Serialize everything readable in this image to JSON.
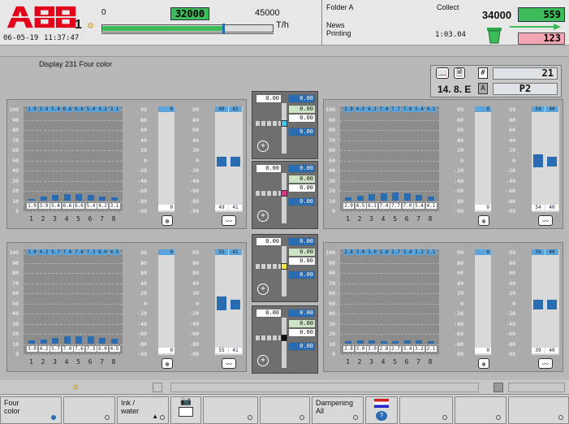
{
  "header": {
    "unit_number": "1",
    "date": "06-05-19",
    "time": "11:37:47",
    "scale_min": "0",
    "speed_current": "32000",
    "scale_max": "45000",
    "speed_unit": "T/h",
    "folder": "Folder A",
    "mode": "Collect",
    "news_line1": "News",
    "news_line2": "Printing",
    "elapsed": "1:03.04",
    "counter_total": "34000",
    "counter_good": "559",
    "counter_waste": "123",
    "brand": "ABB"
  },
  "info": {
    "display_title": "Display 231 Four color",
    "hash": "#",
    "page_count": "21",
    "position": "14. 8. E",
    "section_letter": "A",
    "plate": "P2"
  },
  "blocks": [
    {
      "name": "upper-left",
      "top": [
        "1.9",
        "3.9",
        "5.4",
        "6.6",
        "6.6",
        "5.4",
        "4.2",
        "3.1"
      ],
      "bottom": [
        "1.9",
        "3.9",
        "5.4",
        "6.6",
        "6.6",
        "5.4",
        "4.2",
        "3.1"
      ],
      "bars": [
        1.9,
        3.9,
        5.4,
        6.6,
        6.6,
        5.4,
        4.2,
        3.1
      ],
      "single_top": "0",
      "single_bottom": "0",
      "pair_top": [
        "40",
        "41"
      ],
      "pair_bottom": [
        "49",
        "41"
      ],
      "pair_vals": [
        40,
        41
      ],
      "cols": [
        "1",
        "2",
        "3",
        "4",
        "5",
        "6",
        "7",
        "8"
      ]
    },
    {
      "name": "upper-right",
      "top": [
        "2.9",
        "4.5",
        "6.1",
        "7.4",
        "7.7",
        "7.0",
        "5.4",
        "4.1"
      ],
      "bottom": [
        "2.9",
        "4.5",
        "6.1",
        "7.4",
        "7.7",
        "7.0",
        "5.4",
        "4.1"
      ],
      "bars": [
        2.9,
        4.5,
        6.1,
        7.4,
        7.7,
        7.0,
        5.4,
        4.1
      ],
      "single_top": "0",
      "single_bottom": "0",
      "pair_top": [
        "54",
        "40"
      ],
      "pair_bottom": [
        "54",
        "40"
      ],
      "pair_vals": [
        54,
        40
      ],
      "cols": [
        "1",
        "2",
        "3",
        "4",
        "5",
        "6",
        "7",
        "8"
      ]
    },
    {
      "name": "lower-left",
      "top": [
        "3.0",
        "4.2",
        "5.7",
        "7.0",
        "7.6",
        "7.3",
        "6.0",
        "4.5"
      ],
      "bottom": [
        "3.0",
        "4.2",
        "5.7",
        "7.0",
        "7.6",
        "7.3",
        "6.0",
        "4.5"
      ],
      "bars": [
        3.0,
        4.2,
        5.7,
        7.0,
        7.6,
        7.3,
        6.0,
        4.5
      ],
      "single_top": "0",
      "single_bottom": "0",
      "pair_top": [
        "55",
        "41"
      ],
      "pair_bottom": [
        "55",
        "41"
      ],
      "pair_vals": [
        55,
        41
      ],
      "cols": [
        "1",
        "2",
        "3",
        "4",
        "5",
        "6",
        "7",
        "8"
      ]
    },
    {
      "name": "lower-right",
      "top": [
        "2.8",
        "3.0",
        "3.0",
        "2.8",
        "2.7",
        "3.4",
        "3.2",
        "2.1"
      ],
      "bottom": [
        "2.8",
        "3.0",
        "3.0",
        "2.8",
        "2.7",
        "3.4",
        "3.2",
        "2.1"
      ],
      "bars": [
        2.8,
        3.0,
        3.0,
        2.8,
        2.7,
        3.4,
        3.2,
        2.1
      ],
      "single_top": "0",
      "single_bottom": "0",
      "pair_top": [
        "39",
        "40"
      ],
      "pair_bottom": [
        "39",
        "40"
      ],
      "pair_vals": [
        39,
        40
      ],
      "cols": [
        "1",
        "2",
        "3",
        "4",
        "5",
        "6",
        "7",
        "8"
      ]
    }
  ],
  "scale_left": [
    "100",
    "90",
    "80",
    "70",
    "60",
    "50",
    "40",
    "30",
    "20",
    "10",
    "0"
  ],
  "scale_mid": [
    "99",
    "80",
    "60",
    "40",
    "20",
    "0",
    "-20",
    "-40",
    "-60",
    "-80",
    "-99"
  ],
  "centers": [
    {
      "color": "#3fc6f0",
      "a": "0.00",
      "b": "0.00",
      "c": "0.00",
      "d": "0.00",
      "e": "0.00"
    },
    {
      "color": "#e0358f",
      "a": "0.00",
      "b": "0.00",
      "c": "0.00",
      "d": "0.00",
      "e": "0.00"
    },
    {
      "color": "#f2e640",
      "a": "0.00",
      "b": "0.00",
      "c": "0.00",
      "d": "0.00",
      "e": "0.00"
    },
    {
      "color": "#111111",
      "a": "0.00",
      "b": "0.00",
      "c": "0.00",
      "d": "0.00",
      "e": "0.00"
    }
  ],
  "footer": {
    "btn1": "Four\ncolor",
    "btn3": "Ink /\nwater",
    "btn6": "Dampening\nAll"
  },
  "colors": {
    "bar": "#2a6cb1",
    "header_blue": "#5ba4dc",
    "green": "#3dbb59",
    "pink": "#f4a6b4"
  }
}
